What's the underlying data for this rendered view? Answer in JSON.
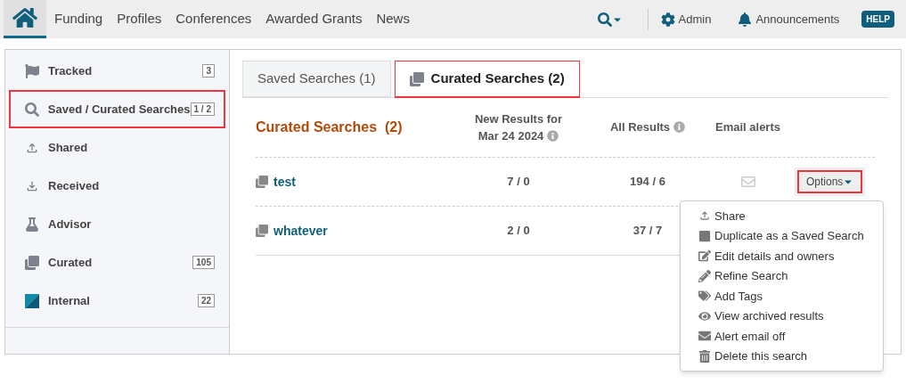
{
  "nav": {
    "links": [
      {
        "label": "Funding"
      },
      {
        "label": "Profiles"
      },
      {
        "label": "Conferences"
      },
      {
        "label": "Awarded Grants"
      },
      {
        "label": "News"
      }
    ],
    "admin": "Admin",
    "announcements": "Announcements",
    "help": "HELP"
  },
  "sidebar": {
    "items": [
      {
        "kind": "flag",
        "label": "Tracked",
        "count": "3",
        "highlighted": false
      },
      {
        "kind": "search",
        "label": "Saved / Curated Searches",
        "count": "1 / 2",
        "highlighted": true
      },
      {
        "kind": "share",
        "label": "Shared",
        "highlighted": false
      },
      {
        "kind": "receive",
        "label": "Received",
        "highlighted": false
      },
      {
        "kind": "flask",
        "label": "Advisor",
        "highlighted": false
      },
      {
        "kind": "copies",
        "label": "Curated",
        "count": "105",
        "highlighted": false
      },
      {
        "kind": "internal",
        "label": "Internal",
        "count": "22",
        "highlighted": false
      }
    ]
  },
  "tabs": [
    {
      "label": "Saved Searches (1)",
      "selected": false,
      "highlighted": false
    },
    {
      "label": "Curated Searches (2)",
      "selected": true,
      "highlighted": true
    }
  ],
  "table": {
    "title": "Curated Searches  (2)",
    "columns": [
      {
        "label": "New Results for Mar 24 2024",
        "info": true
      },
      {
        "label": "All Results",
        "info": true
      },
      {
        "label": "Email alerts",
        "info": false
      }
    ],
    "rows": [
      {
        "name": "test",
        "new_results": "7 / 0",
        "all_results": "194 / 6",
        "options": "Options",
        "options_highlighted": true
      },
      {
        "name": "whatever",
        "new_results": "2 / 0",
        "all_results": "37 / 7"
      }
    ]
  },
  "menu": {
    "items": [
      {
        "kind": "share",
        "label": "Share"
      },
      {
        "kind": "square",
        "label": "Duplicate as a Saved Search"
      },
      {
        "kind": "edit",
        "label": "Edit details and owners"
      },
      {
        "kind": "pencil",
        "label": "Refine Search"
      },
      {
        "kind": "tag",
        "label": "Add Tags"
      },
      {
        "kind": "eye",
        "label": "View archived results"
      },
      {
        "kind": "mail",
        "label": "Alert email off"
      },
      {
        "kind": "trash",
        "label": "Delete this search"
      }
    ]
  }
}
